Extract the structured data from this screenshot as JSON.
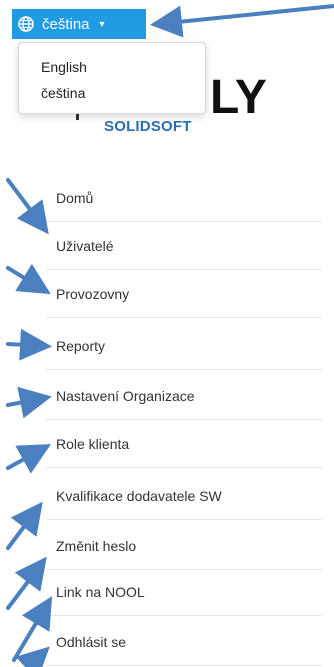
{
  "header": {
    "language_button_label": "čeština",
    "globe_icon": "globe-icon",
    "caret_icon": "chevron-down-icon",
    "accent_color": "#1e9be3"
  },
  "language_menu": {
    "options": [
      "English",
      "čeština"
    ]
  },
  "logo": {
    "partial_text": "LY",
    "subtitle": "SOLIDSOFT"
  },
  "sidebar": {
    "items": [
      {
        "label": "Domů"
      },
      {
        "label": "Uživatelé"
      },
      {
        "label": "Provozovny"
      },
      {
        "label": "Reporty"
      },
      {
        "label": "Nastavení Organizace"
      },
      {
        "label": "Role klienta"
      },
      {
        "label": "Kvalifikace dodavatele SW"
      },
      {
        "label": "Změnit heslo"
      },
      {
        "label": "Link na NOOL"
      },
      {
        "label": "Odhlásit se"
      }
    ]
  },
  "annotations": {
    "arrow_color": "#4a7fc0"
  }
}
